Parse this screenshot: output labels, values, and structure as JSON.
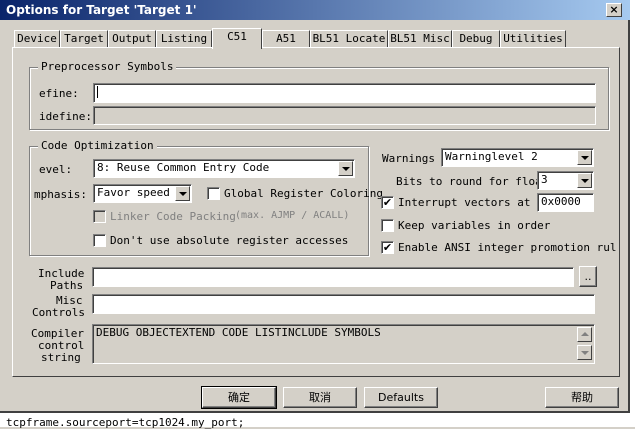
{
  "window": {
    "title": "Options for Target 'Target 1'",
    "close_glyph": "×"
  },
  "background": {
    "code_line": "tcpframe.sourceport=tcp1024.my_port;"
  },
  "tabs": [
    {
      "label": "Device"
    },
    {
      "label": "Target"
    },
    {
      "label": "Output"
    },
    {
      "label": "Listing"
    },
    {
      "label": "C51"
    },
    {
      "label": "A51"
    },
    {
      "label": "BL51 Locate"
    },
    {
      "label": "BL51 Misc"
    },
    {
      "label": "Debug"
    },
    {
      "label": "Utilities"
    }
  ],
  "active_tab": "C51",
  "preprocessor": {
    "title": "Preprocessor Symbols",
    "define_label": "efine:",
    "define_value": "",
    "undefine_label": "idefine:",
    "undefine_value": ""
  },
  "code_optimization": {
    "title": "Code Optimization",
    "level_label": "evel:",
    "level_value": "8: Reuse Common Entry Code",
    "emphasis_label": "mphasis:",
    "emphasis_value": "Favor speed",
    "global_register_coloring": {
      "label": "Global Register Coloring",
      "checked": false
    },
    "linker_code_packing": {
      "label": "Linker Code Packing",
      "hint": "(max. AJMP / ACALL)",
      "checked": false,
      "disabled": true
    },
    "no_absolute_register": {
      "label": "Don't use absolute register accesses",
      "checked": false
    }
  },
  "warnings": {
    "label": "Warnings",
    "value": "Warninglevel 2"
  },
  "bits_to_round": {
    "label": "Bits to round for float",
    "value": "3"
  },
  "interrupt_vectors": {
    "label": "Interrupt vectors at a",
    "checked": true,
    "value": "0x0000"
  },
  "keep_variables": {
    "label": "Keep variables in order",
    "checked": false
  },
  "ansi_promotion": {
    "label": "Enable ANSI integer promotion rul",
    "checked": true
  },
  "include_paths": {
    "label_line1": "Include",
    "label_line2": "Paths",
    "value": "",
    "browse_label": ".."
  },
  "misc_controls": {
    "label_line1": "Misc",
    "label_line2": "Controls",
    "value": ""
  },
  "compiler_control": {
    "label_line1": "Compiler",
    "label_line2": "control",
    "label_line3": "string",
    "value": "DEBUG OBJECTEXTEND CODE LISTINCLUDE SYMBOLS"
  },
  "buttons": {
    "ok": "确定",
    "cancel": "取消",
    "defaults": "Defaults",
    "help": "帮助"
  },
  "check_mark": "✔"
}
